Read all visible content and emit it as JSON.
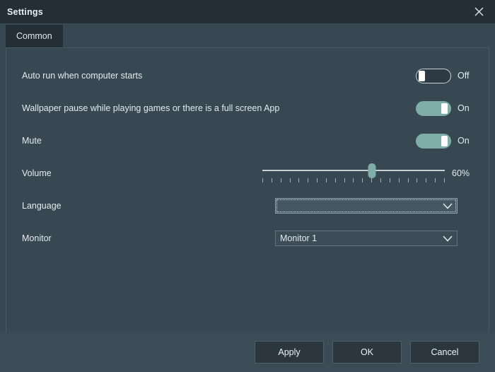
{
  "window": {
    "title": "Settings",
    "close_icon": "close-icon"
  },
  "tabs": [
    {
      "label": "Common",
      "active": true
    }
  ],
  "settings": {
    "autorun": {
      "label": "Auto run when computer starts",
      "state": "Off",
      "on": false
    },
    "wallpaper_pause": {
      "label": "Wallpaper pause while playing games or there is a full screen App",
      "state": "On",
      "on": true
    },
    "mute": {
      "label": "Mute",
      "state": "On",
      "on": true
    },
    "volume": {
      "label": "Volume",
      "value": "60%",
      "percent": 60,
      "ticks": 21
    },
    "language": {
      "label": "Language",
      "value": "",
      "arrow_icon": "chevron-down-icon"
    },
    "monitor": {
      "label": "Monitor",
      "value": "Monitor 1",
      "arrow_icon": "chevron-down-icon"
    }
  },
  "footer": {
    "apply_label": "Apply",
    "ok_label": "OK",
    "cancel_label": "Cancel"
  },
  "colors": {
    "titlebar_bg": "#242e35",
    "body_bg": "#374852",
    "accent_teal": "#7eaea7",
    "footer_bg": "#3b4c56",
    "button_bg": "#2b363d"
  }
}
